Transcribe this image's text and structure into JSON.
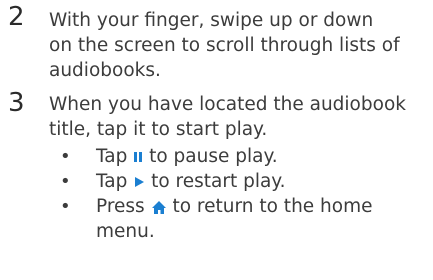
{
  "steps": [
    {
      "number": "2",
      "lines": [
        "With your finger, swipe up or down",
        "on the screen to scroll through lists of",
        "audiobooks."
      ]
    },
    {
      "number": "3",
      "lines": [
        "When you have located the audiobook",
        "title, tap it to start play."
      ],
      "bullets": [
        {
          "dot": "•",
          "before": "Tap ",
          "icon": "pause-icon",
          "after": " to pause play."
        },
        {
          "dot": "•",
          "before": "Tap ",
          "icon": "play-icon",
          "after": " to restart play."
        },
        {
          "dot": "•",
          "before": "Press ",
          "icon": "home-icon",
          "after": " to return to the home",
          "line2": "menu."
        }
      ]
    }
  ],
  "colors": {
    "accent": "#1b7fd1",
    "text": "#3c3c3c"
  }
}
